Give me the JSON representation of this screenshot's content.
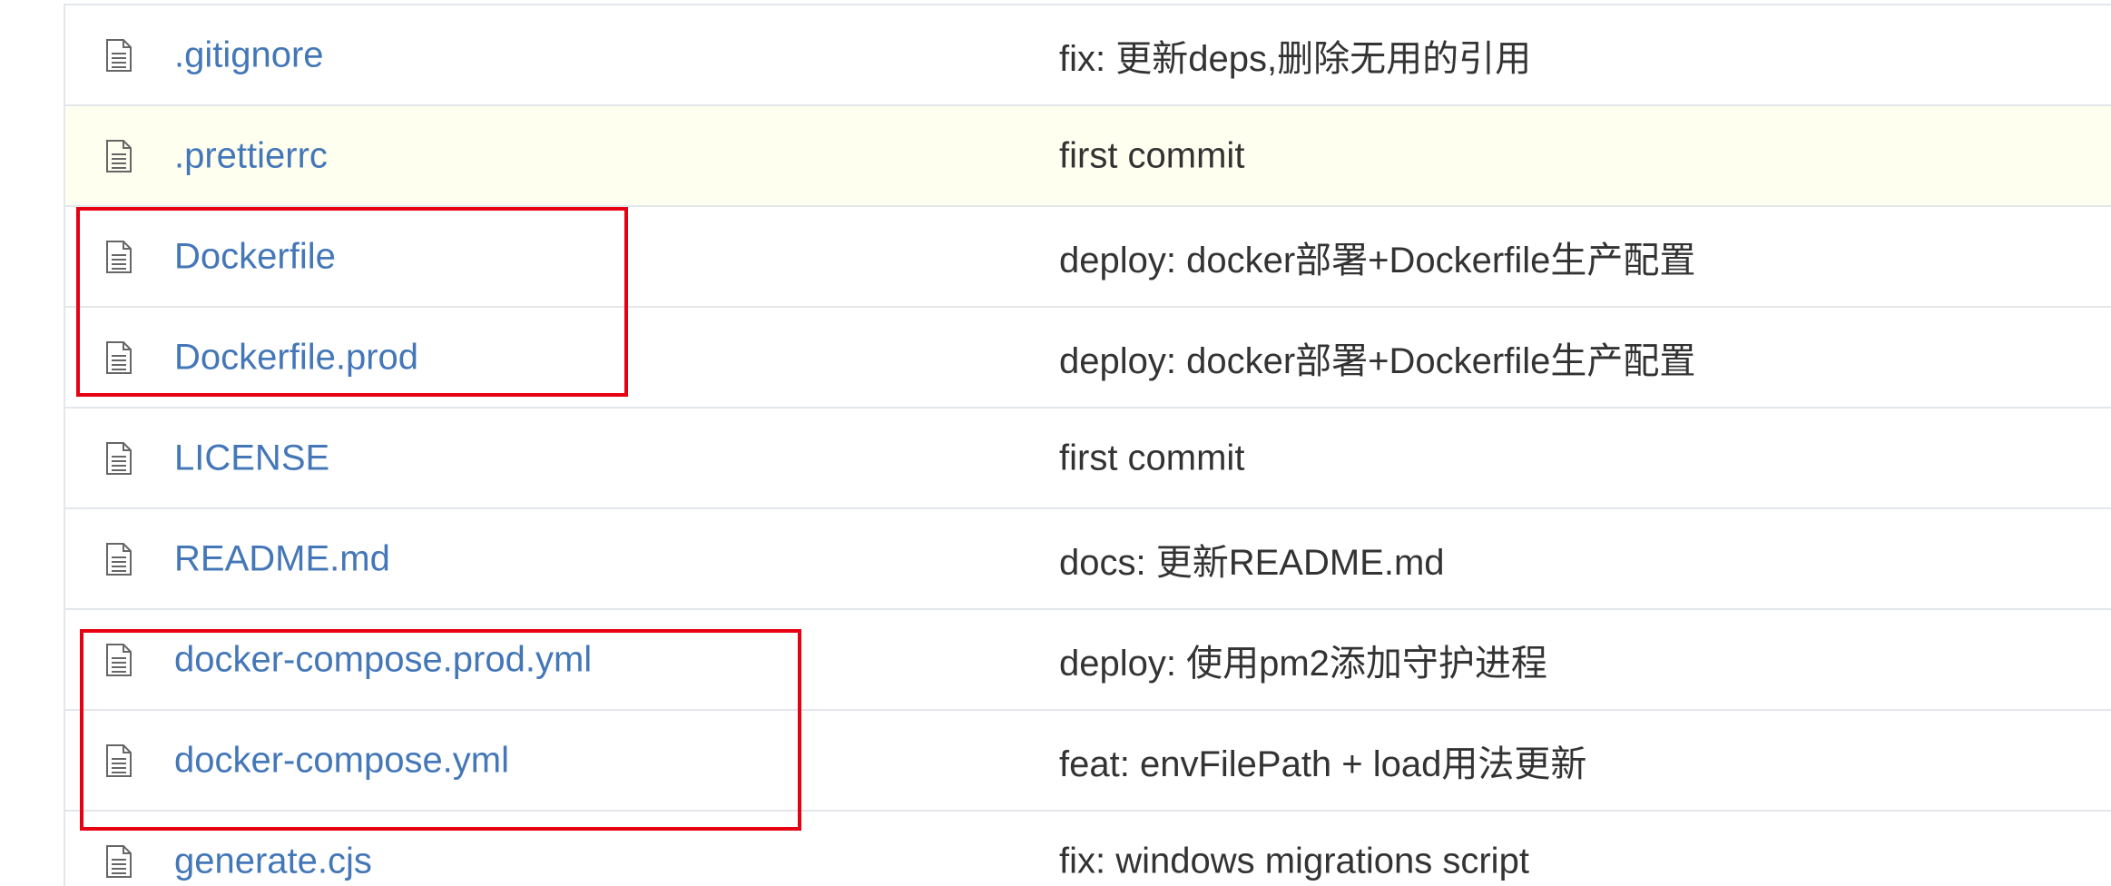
{
  "files": [
    {
      "name": ".gitignore",
      "message": "fix: 更新deps,删除无用的引用",
      "icon": "file-icon"
    },
    {
      "name": ".prettierrc",
      "message": "first commit",
      "icon": "file-icon"
    },
    {
      "name": "Dockerfile",
      "message": "deploy: docker部署+Dockerfile生产配置",
      "icon": "file-icon"
    },
    {
      "name": "Dockerfile.prod",
      "message": "deploy: docker部署+Dockerfile生产配置",
      "icon": "file-icon"
    },
    {
      "name": "LICENSE",
      "message": "first commit",
      "icon": "file-icon"
    },
    {
      "name": "README.md",
      "message": "docs: 更新README.md",
      "icon": "file-icon"
    },
    {
      "name": "docker-compose.prod.yml",
      "message": "deploy: 使用pm2添加守护进程",
      "icon": "file-icon"
    },
    {
      "name": "docker-compose.yml",
      "message": "feat: envFilePath + load用法更新",
      "icon": "file-icon"
    },
    {
      "name": "generate.cjs",
      "message": "fix: windows migrations script",
      "icon": "file-icon"
    }
  ],
  "colors": {
    "link": "#4477b8",
    "message": "#333333",
    "border": "#e3e6ea",
    "highlight_row": "#fffff0",
    "annotation": "#e60012"
  }
}
